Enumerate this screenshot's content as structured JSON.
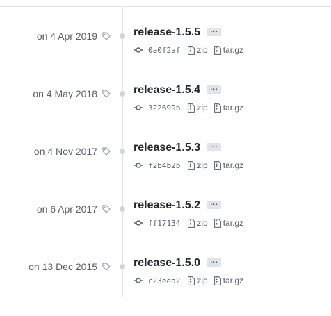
{
  "releases": [
    {
      "date": "on 4 Apr 2019",
      "title": "release-1.5.5",
      "sha": "0a0f2af",
      "zip_label": "zip",
      "tar_label": "tar.gz",
      "more_label": "..."
    },
    {
      "date": "on 4 May 2018",
      "title": "release-1.5.4",
      "sha": "322699b",
      "zip_label": "zip",
      "tar_label": "tar.gz",
      "more_label": "..."
    },
    {
      "date": "on 4 Nov 2017",
      "title": "release-1.5.3",
      "sha": "f2b4b2b",
      "zip_label": "zip",
      "tar_label": "tar.gz",
      "more_label": "..."
    },
    {
      "date": "on 6 Apr 2017",
      "title": "release-1.5.2",
      "sha": "ff17134",
      "zip_label": "zip",
      "tar_label": "tar.gz",
      "more_label": "..."
    },
    {
      "date": "on 13 Dec 2015",
      "title": "release-1.5.0",
      "sha": "c23eea2",
      "zip_label": "zip",
      "tar_label": "tar.gz",
      "more_label": "..."
    }
  ],
  "icons": {
    "tag": "tag-icon",
    "commit": "git-commit-icon",
    "archive": "file-zip-icon"
  },
  "colors": {
    "title": "#24292e",
    "muted": "#586069",
    "timeline": "#e1e4e8",
    "dot": "#d1d5da"
  }
}
